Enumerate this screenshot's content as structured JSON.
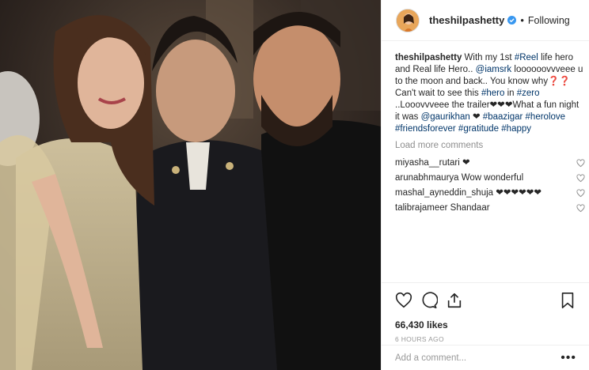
{
  "header": {
    "username": "theshilpashetty",
    "separator": "•",
    "follow_status": "Following"
  },
  "caption": {
    "username": "theshilpashetty",
    "t1": " With my 1st ",
    "l1": "#Reel",
    "t2": " life hero and Real life Hero.. ",
    "l2": "@iamsrk",
    "t3": " loooooovvveee u to the moon and back.. You know why❓❓ Can't wait to see this ",
    "l3": "#hero",
    "t4": " in ",
    "l4": "#zero",
    "t5": " ..Looovvveee the trailer❤❤❤What a fun night it was ",
    "l5": "@gaurikhan",
    "t6": " ❤ ",
    "l6": "#baazigar",
    "t7": " ",
    "l7": "#herolove",
    "t8": " ",
    "l8": "#friendsforever",
    "t9": " ",
    "l9": "#gratitude",
    "t10": " ",
    "l10": "#happy"
  },
  "load_more": "Load more comments",
  "comments": [
    {
      "user": "miyasha__rutari",
      "text": " ❤"
    },
    {
      "user": "arunabhmaurya",
      "text": " Wow wonderful"
    },
    {
      "user": "mashal_ayneddin_shuja",
      "text": " ❤❤❤❤❤❤"
    },
    {
      "user": "talibrajameer",
      "text": " Shandaar"
    }
  ],
  "likes": "66,430 likes",
  "timestamp": "6 HOURS AGO",
  "add_comment_placeholder": "Add a comment...",
  "more_options": "•••",
  "colors": {
    "link": "#003569",
    "verified": "#3897f0",
    "muted": "#8e8e8e",
    "text": "#262626"
  },
  "icons": [
    "verified-badge-icon",
    "heart-icon",
    "comment-icon",
    "share-icon",
    "bookmark-icon",
    "more-options-icon"
  ]
}
